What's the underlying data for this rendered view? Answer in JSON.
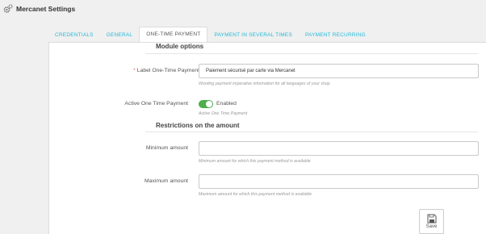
{
  "header": {
    "title": "Mercanet Settings",
    "icon": "cogs-icon"
  },
  "tabs": [
    {
      "label": "CREDENTIALS",
      "active": false
    },
    {
      "label": "GENERAL",
      "active": false
    },
    {
      "label": "ONE-TIME PAYMENT",
      "active": true
    },
    {
      "label": "PAYMENT IN SEVERAL TIMES",
      "active": false
    },
    {
      "label": "PAYMENT RECURRING",
      "active": false
    }
  ],
  "module_options": {
    "title": "Module options",
    "label_field": {
      "required_mark": "*",
      "label": "Label One-Time Payment",
      "value": "Paiement sécurisé par carte via Mercanet",
      "help": "Wording payment imperative information for all languages of your shop"
    },
    "active_field": {
      "label": "Active One Time Payment",
      "toggle_text": "Enabled",
      "enabled": true,
      "help": "Active One Time Payment"
    }
  },
  "restrictions": {
    "title": "Restrictions on the amount",
    "min_field": {
      "label": "Minimum amount",
      "value": "",
      "help": "Minimum amount for which this payment method is available"
    },
    "max_field": {
      "label": "Maximum amount",
      "value": "",
      "help": "Maximum amount for which this payment method is available"
    }
  },
  "footer": {
    "save_label": "Save"
  },
  "colors": {
    "accent": "#25b9d7",
    "toggle_on": "#4cae4c",
    "required": "#ee5555"
  }
}
